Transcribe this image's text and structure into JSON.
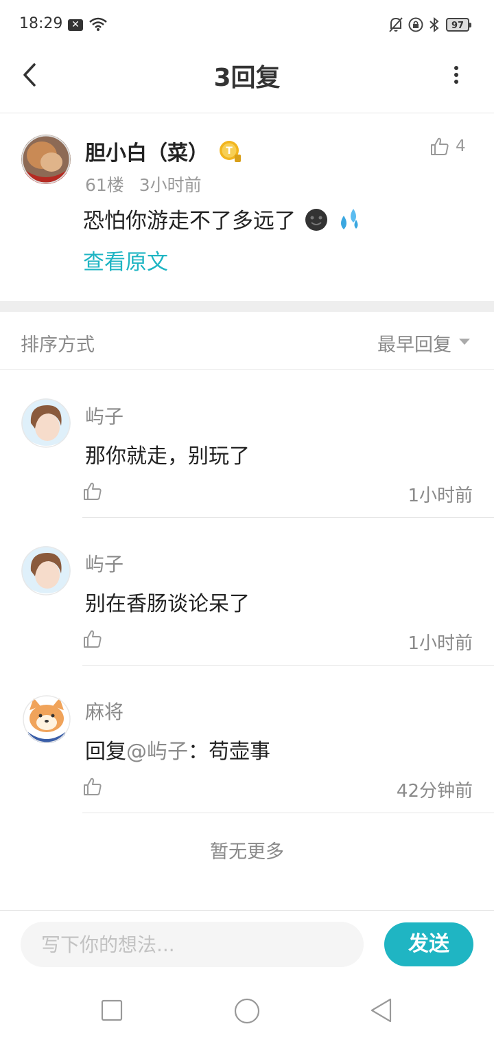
{
  "status_bar": {
    "time": "18:29",
    "battery": "97"
  },
  "header": {
    "title": "3回复"
  },
  "post": {
    "author": "胆小白（菜）",
    "floor": "61楼",
    "time": "3小时前",
    "content": "恐怕你游走不了多远了",
    "like_count": "4",
    "view_original": "查看原文"
  },
  "sort": {
    "label": "排序方式",
    "value": "最早回复"
  },
  "replies": [
    {
      "name": "屿子",
      "text": "那你就走，别玩了",
      "time": "1小时前"
    },
    {
      "name": "屿子",
      "text": "别在香肠谈论呆了",
      "time": "1小时前"
    },
    {
      "name": "麻将",
      "prefix": "回复",
      "mention": "@屿子",
      "text": "：苟壶事",
      "time": "42分钟前"
    }
  ],
  "no_more": "暂无更多",
  "composer": {
    "placeholder": "写下你的想法...",
    "send": "发送"
  },
  "colors": {
    "accent": "#1fb5c3",
    "text": "#222222",
    "muted": "#8a8a8a"
  }
}
